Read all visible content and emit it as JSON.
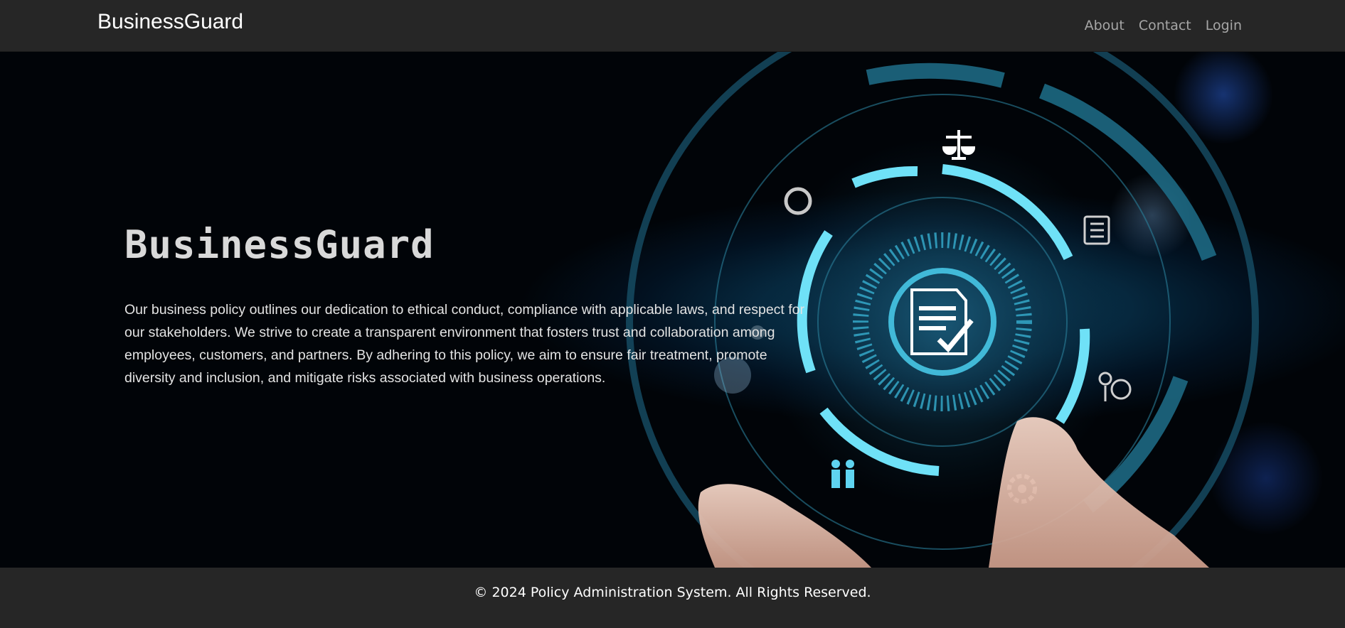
{
  "navbar": {
    "brand": "BusinessGuard",
    "links": [
      {
        "label": "About"
      },
      {
        "label": "Contact"
      },
      {
        "label": "Login"
      }
    ]
  },
  "hero": {
    "title": "BusinessGuard",
    "description": "Our business policy outlines our dedication to ethical conduct, compliance with applicable laws, and respect for our stakeholders. We strive to create a transparent environment that fosters trust and collaboration among employees, customers, and partners. By adhering to this policy, we aim to ensure fair treatment, promote diversity and inclusion, and mitigate risks associated with business operations.",
    "image_icons": [
      "scales-icon",
      "compass-icon",
      "checklist-icon",
      "document-check-icon",
      "info-person-icon",
      "people-icon",
      "gear-icon",
      "hand-image"
    ]
  },
  "footer": {
    "copyright": "© 2024 Policy Administration System. All Rights Reserved."
  },
  "colors": {
    "navbar_bg": "#262626",
    "footer_bg": "#262626",
    "accent_cyan": "#5fd4f0",
    "nav_link": "#a6a6a6"
  }
}
